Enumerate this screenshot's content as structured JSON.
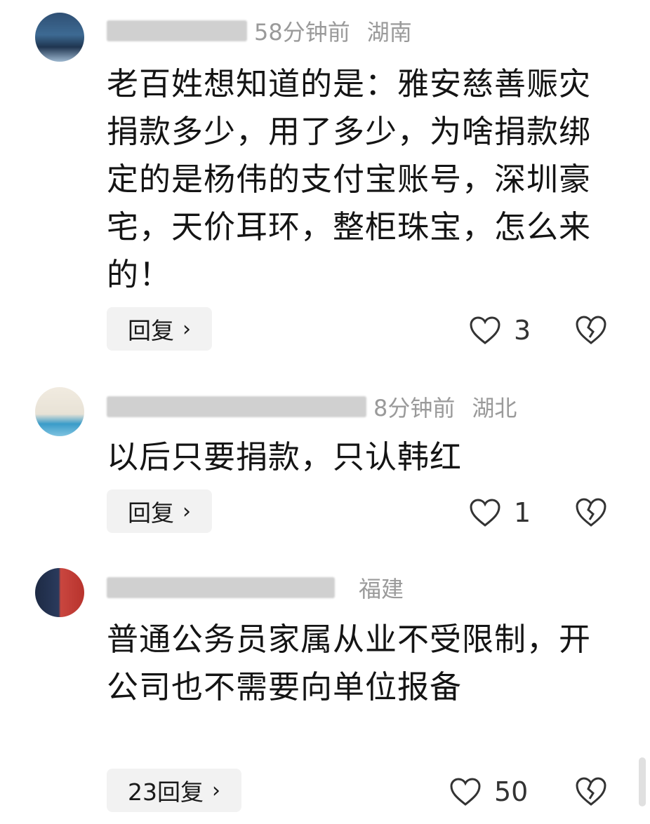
{
  "comments": [
    {
      "time": "58分钟前",
      "location": "湖南",
      "text": "老百姓想知道的是：雅安慈善赈灾捐款多少，用了多少，为啥捐款绑定的是杨伟的支付宝账号，深圳豪宅，天价耳环，整柜珠宝，怎么来的！",
      "reply_label": "回复",
      "likes": "3"
    },
    {
      "time": "8分钟前",
      "location": "湖北",
      "text": "以后只要捐款，只认韩红",
      "reply_label": "回复",
      "likes": "1"
    },
    {
      "time": "",
      "location": "福建",
      "text": "普通公务员家属从业不受限制，开公司也不需要向单位报备",
      "reply_label": "23回复",
      "likes": "50"
    }
  ],
  "icons": {
    "like": "heart-outline-icon",
    "dislike": "broken-heart-icon",
    "chevron": "chevron-right-icon"
  },
  "colors": {
    "meta_text": "#9a9a9a",
    "reply_bg": "#f2f2f2",
    "icon_stroke": "#333333"
  }
}
